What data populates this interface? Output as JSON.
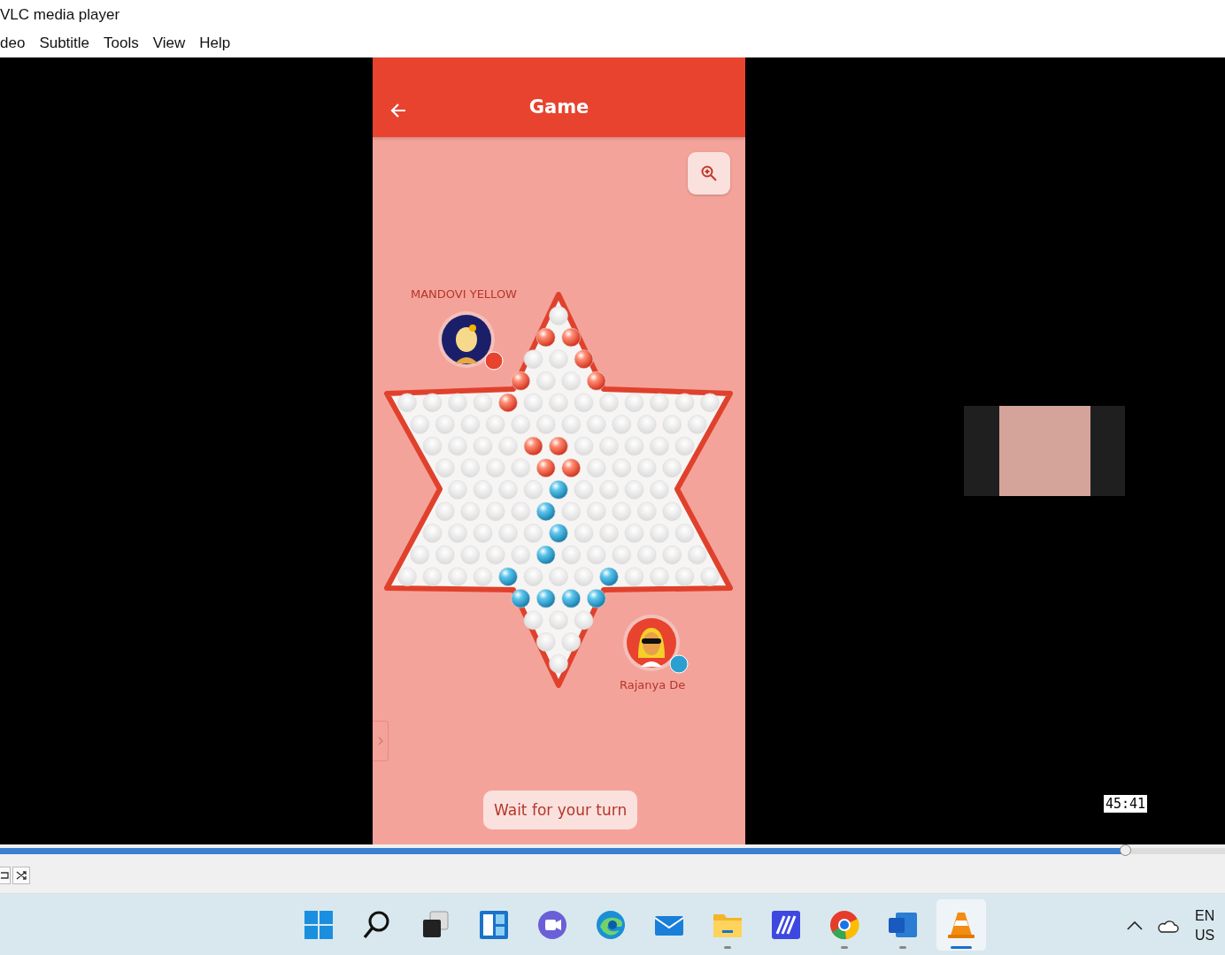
{
  "window": {
    "title": "VLC media player"
  },
  "menu": [
    "deo",
    "Subtitle",
    "Tools",
    "View",
    "Help"
  ],
  "game": {
    "title": "Game",
    "players": [
      {
        "name": "MANDOVI YELLOW",
        "color": "#e8432e",
        "kind": "top"
      },
      {
        "name": "Rajanya De",
        "color": "#2a9fd0",
        "kind": "bottom"
      }
    ],
    "status": "Wait for your turn"
  },
  "video": {
    "time_tooltip": "45:41"
  },
  "seek": {
    "level": 0.918
  },
  "taskbar": {
    "apps": [
      {
        "kind": "start",
        "running": false,
        "selected": false
      },
      {
        "kind": "search",
        "running": false,
        "selected": false
      },
      {
        "kind": "taskview",
        "running": false,
        "selected": false
      },
      {
        "kind": "widgets",
        "running": false,
        "selected": false
      },
      {
        "kind": "chat",
        "running": false,
        "selected": false
      },
      {
        "kind": "edge",
        "running": false,
        "selected": false
      },
      {
        "kind": "mail",
        "running": false,
        "selected": false
      },
      {
        "kind": "folder",
        "running": true,
        "selected": false
      },
      {
        "kind": "app",
        "running": false,
        "selected": false
      },
      {
        "kind": "chrome",
        "running": true,
        "selected": false
      },
      {
        "kind": "word",
        "running": true,
        "selected": false
      },
      {
        "kind": "vlc",
        "running": true,
        "selected": true
      }
    ],
    "language": [
      "EN",
      "US"
    ]
  }
}
